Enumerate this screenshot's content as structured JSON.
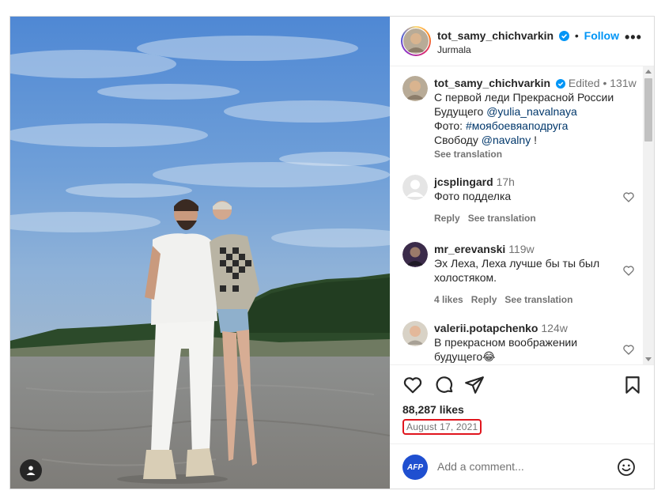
{
  "post": {
    "username": "tot_samy_chichvarkin",
    "follow_label": "Follow",
    "location": "Jurmala",
    "more_label": "•••"
  },
  "caption": {
    "username": "tot_samy_chichvarkin",
    "edited": "Edited",
    "separator": "•",
    "time": "131w",
    "line1": "С первой леди Прекрасной России",
    "line2_text": "Будущего ",
    "line2_mention": "@yulia_navalnaya",
    "line3_text": "Фото: ",
    "line3_tag": "#моябоевяаподруга",
    "line4_text": "Свободу ",
    "line4_mention": "@navalny",
    "line4_end": " !",
    "see_translation": "See translation"
  },
  "comments": [
    {
      "username": "jcsplingard",
      "time": "17h",
      "text": "Фото подделка",
      "likes": "",
      "reply": "Reply",
      "see_translation": "See translation"
    },
    {
      "username": "mr_erevanski",
      "time": "119w",
      "text": "Эх Леха, Леха лучше бы ты был холостяком.",
      "likes": "4 likes",
      "reply": "Reply",
      "see_translation": "See translation"
    },
    {
      "username": "valerii.potapchenko",
      "time": "124w",
      "text": "В прекрасном воображении будущего😂",
      "likes": "",
      "reply": "",
      "see_translation": ""
    }
  ],
  "stats": {
    "likes": "88,287 likes",
    "date": "August 17, 2021"
  },
  "composer": {
    "avatar_label": "AFP",
    "placeholder": "Add a comment..."
  },
  "colors": {
    "follow": "#0095f6",
    "verified": "#0095f6",
    "date_highlight": "#e0151d",
    "mention": "#00376b"
  }
}
